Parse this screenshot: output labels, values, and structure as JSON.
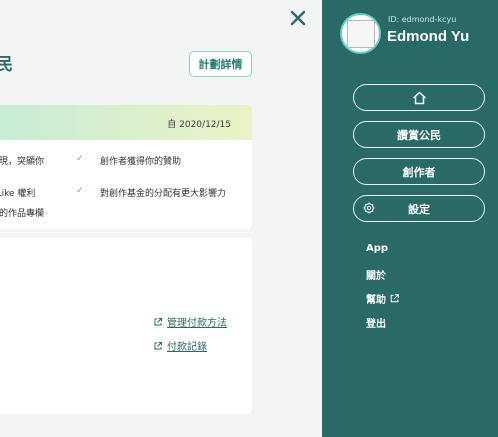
{
  "page": {
    "title": "民",
    "plan_button": "計劃詳情",
    "plan_card": {
      "since": "自 2020/12/15",
      "features_left": [
        "起現，突顯你",
        "r Like 權利",
        "己的作品專欄"
      ],
      "features_right": [
        "創作者獲得你的贊助",
        "對創作基金的分配有更大影響力"
      ]
    },
    "payment": {
      "manage_label": "管理付款方法",
      "records_label": "付款記錄"
    }
  },
  "drawer": {
    "user_id": "ID: edmond-kcyu",
    "user_name": "Edmond Yu",
    "buttons": {
      "civic": "讚賞公民",
      "creator": "創作者",
      "settings": "設定"
    },
    "links": {
      "app": "App",
      "about": "關於",
      "help": "幫助",
      "logout": "登出"
    }
  },
  "colors": {
    "drawer_bg": "#2a6a66",
    "accent": "#2d6a63",
    "check": "#49c17b"
  }
}
